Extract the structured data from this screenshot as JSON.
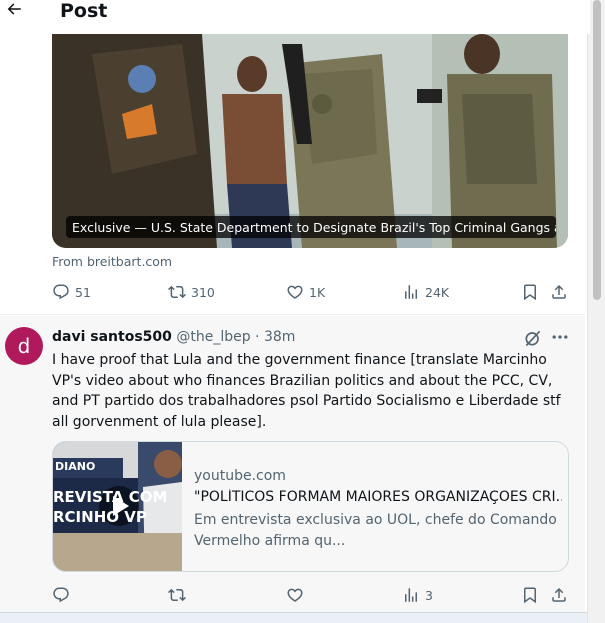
{
  "header": {
    "title": "Post",
    "back_icon": "arrow-left-icon"
  },
  "article": {
    "caption": "Exclusive — U.S. State Department to Designate Brazil's Top Criminal Gangs as T...",
    "source": "From breitbart.com",
    "stats": {
      "replies": "51",
      "reposts": "310",
      "likes": "1K",
      "views": "24K"
    }
  },
  "reply": {
    "avatar_letter": "d",
    "avatar_color": "#b0195b",
    "display_name": "davi santos500",
    "handle": "@the_lbep",
    "separator": " · ",
    "time": "38m",
    "text": "I have proof that Lula and the government finance [translate Marcinho VP's video about who finances Brazilian politics and about the PCC, CV, and PT partido dos trabalhadores psol Partido Socialismo e Liberdade stf all gorvenment of lula please].",
    "link_card": {
      "domain": "youtube.com",
      "title": "\"POLÍTICOS FORMAM MAIORES ORGANIZAÇÕES CRI...",
      "description": "Em entrevista exclusiva ao UOL, chefe do Comando Vermelho afirma qu...",
      "thumb_text_1": "DIANO",
      "thumb_text_2": "REVISTA COM",
      "thumb_text_3": "RCINHO VP"
    },
    "stats": {
      "views": "3"
    }
  }
}
